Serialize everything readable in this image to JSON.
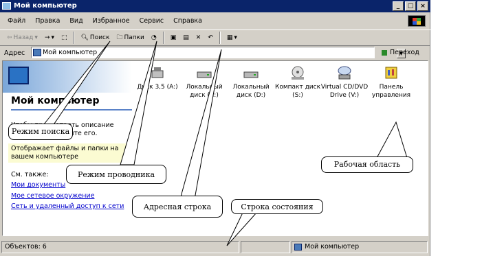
{
  "window": {
    "title": "Мой компьютер",
    "controls": {
      "minimize": "_",
      "maximize": "□",
      "close": "×"
    }
  },
  "menu": [
    "Файл",
    "Правка",
    "Вид",
    "Избранное",
    "Сервис",
    "Справка"
  ],
  "toolbar": {
    "back": "Назад",
    "search": "Поиск",
    "folders": "Папки"
  },
  "address": {
    "label": "Адрес",
    "value": "Мой компьютер",
    "go": "Переход"
  },
  "left_panel": {
    "title": "Мой компьютер",
    "desc": "Чтобы просмотреть описание элемента, выделите его.",
    "hint": "Отображает файлы и папки на вашем компьютере",
    "see_also": "См. также:",
    "links": [
      "Мои документы",
      "Мое сетевое окружение",
      "Сеть и удаленный доступ к сети"
    ]
  },
  "items": [
    {
      "label": "Диск 3,5 (A:)",
      "icon": "floppy-drive-icon"
    },
    {
      "label": "Локальный диск (C:)",
      "icon": "hard-drive-icon"
    },
    {
      "label": "Локальный диск (D:)",
      "icon": "hard-drive-icon"
    },
    {
      "label": "Компакт диск (S:)",
      "icon": "cd-drive-icon"
    },
    {
      "label": "Virtual CD/DVD Drive (V:)",
      "icon": "virtual-drive-icon"
    },
    {
      "label": "Панель управления",
      "icon": "control-panel-icon"
    }
  ],
  "status": {
    "count": "Объектов: 6",
    "location": "Мой компьютер"
  },
  "callouts": {
    "search": "Режим поиска",
    "explorer": "Режим проводника",
    "address": "Адресная строка",
    "statusbar": "Строка состояния",
    "workarea": "Рабочая область"
  }
}
